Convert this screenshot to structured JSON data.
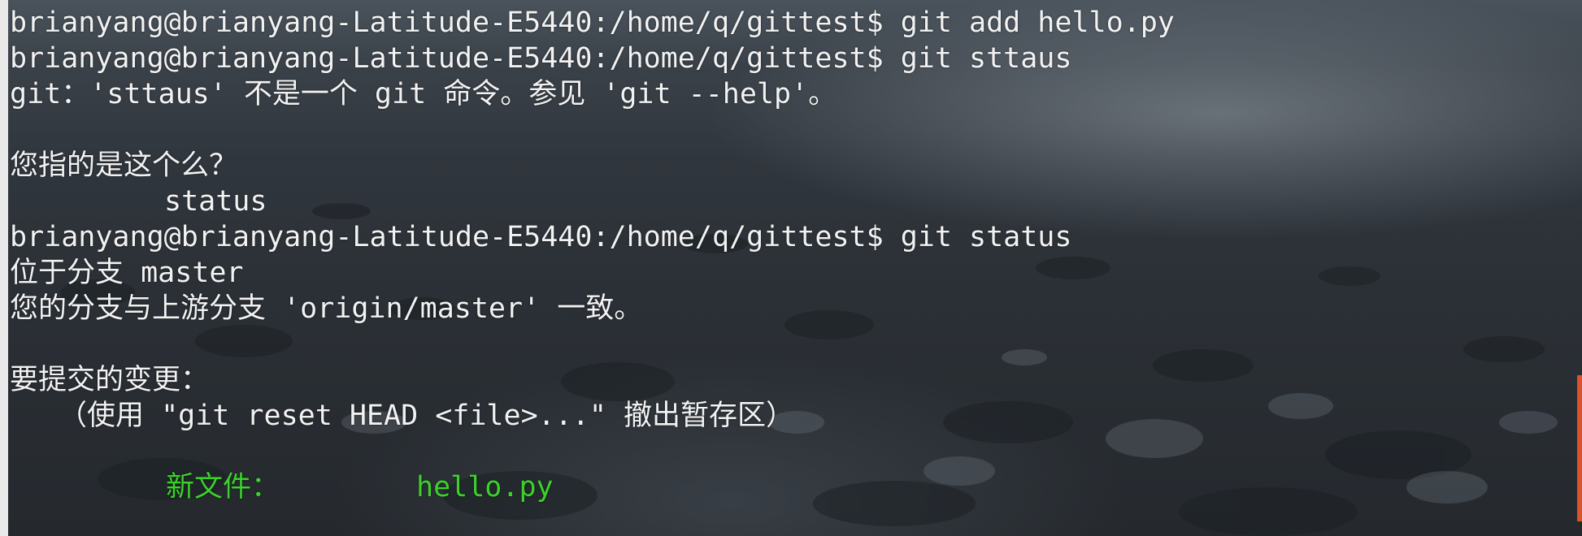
{
  "terminal": {
    "lines": [
      "brianyang@brianyang-Latitude-E5440:/home/q/gittest$ git add hello.py",
      "brianyang@brianyang-Latitude-E5440:/home/q/gittest$ git sttaus",
      "git：'sttaus' 不是一个 git 命令。参见 'git --help'。",
      "",
      "您指的是这个么？",
      "status",
      "brianyang@brianyang-Latitude-E5440:/home/q/gittest$ git status",
      "位于分支 master",
      "您的分支与上游分支 'origin/master' 一致。",
      "",
      "要提交的变更：",
      "（使用 \"git reset HEAD <file>...\" 撤出暂存区）",
      ""
    ],
    "new_file_label": "新文件：",
    "new_file_name": "hello.py",
    "colors": {
      "text": "#f2f2f2",
      "staged": "#3bd12a",
      "scroll_indicator": "#d9542b"
    }
  }
}
